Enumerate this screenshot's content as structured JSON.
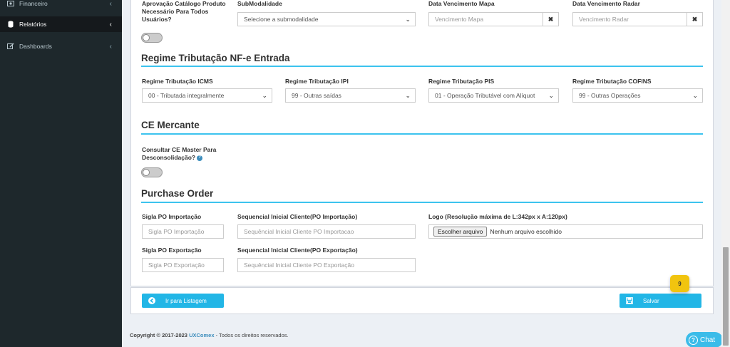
{
  "sidebar": {
    "items": [
      {
        "label": "Financeiro",
        "icon": "money-icon"
      },
      {
        "label": "Relatórios",
        "icon": "database-icon"
      },
      {
        "label": "Dashboards",
        "icon": "edit-icon"
      }
    ]
  },
  "top_fields": {
    "aprovacao_label": "Aprovação Catálogo Produto Necessário Para Todos Usuários?",
    "submodalidade_label": "SubModalidade",
    "submodalidade_value": "Selecione a submodalidade",
    "venc_mapa_label": "Data Vencimento Mapa",
    "venc_mapa_placeholder": "Vencimento Mapa",
    "venc_radar_label": "Data Vencimento Radar",
    "venc_radar_placeholder": "Vencimento Radar"
  },
  "regime": {
    "title": "Regime Tributação NF-e Entrada",
    "icms_label": "Regime Tributação ICMS",
    "icms_value": "00 - Tributada integralmente",
    "ipi_label": "Regime Tributação IPI",
    "ipi_value": "99 - Outras saídas",
    "pis_label": "Regime Tributação PIS",
    "pis_value": "01 - Operação Tributável com Alíquot",
    "cofins_label": "Regime Tributação COFINS",
    "cofins_value": "99 - Outras Operações"
  },
  "ce_mercante": {
    "title": "CE Mercante",
    "consultar_label": "Consultar CE Master Para Desconsolidação?"
  },
  "purchase_order": {
    "title": "Purchase Order",
    "sigla_imp_label": "Sigla PO Importação",
    "sigla_imp_placeholder": "Sigla PO Importação",
    "seq_imp_label": "Sequencial Inicial Cliente(PO Importação)",
    "seq_imp_placeholder": "Sequêncial Inicial Cliente PO Importacao",
    "logo_label": "Logo (Resolução máxima de L:342px x A:120px)",
    "file_button": "Escolher arquivo",
    "file_status": "Nenhum arquivo escolhido",
    "sigla_exp_label": "Sigla PO Exportação",
    "sigla_exp_placeholder": "Sigla PO Exportação",
    "seq_exp_label": "Sequencial Inicial Cliente(PO Exportação)",
    "seq_exp_placeholder": "Sequêncial Inicial Cliente PO Exportação"
  },
  "actions": {
    "listagem_label": "Ir para Listagem",
    "salvar_label": "Salvar",
    "badge": "9"
  },
  "footer": {
    "copyright_prefix": "Copyright © 2017-2023",
    "brand": "UXComex",
    "suffix": "- Todos os direitos reservados."
  },
  "chat": {
    "label": "Chat",
    "icon_glyph": "?"
  },
  "colors": {
    "accent": "#22b6e6",
    "sidebar": "#1e282c",
    "badge": "#f1c40f"
  }
}
